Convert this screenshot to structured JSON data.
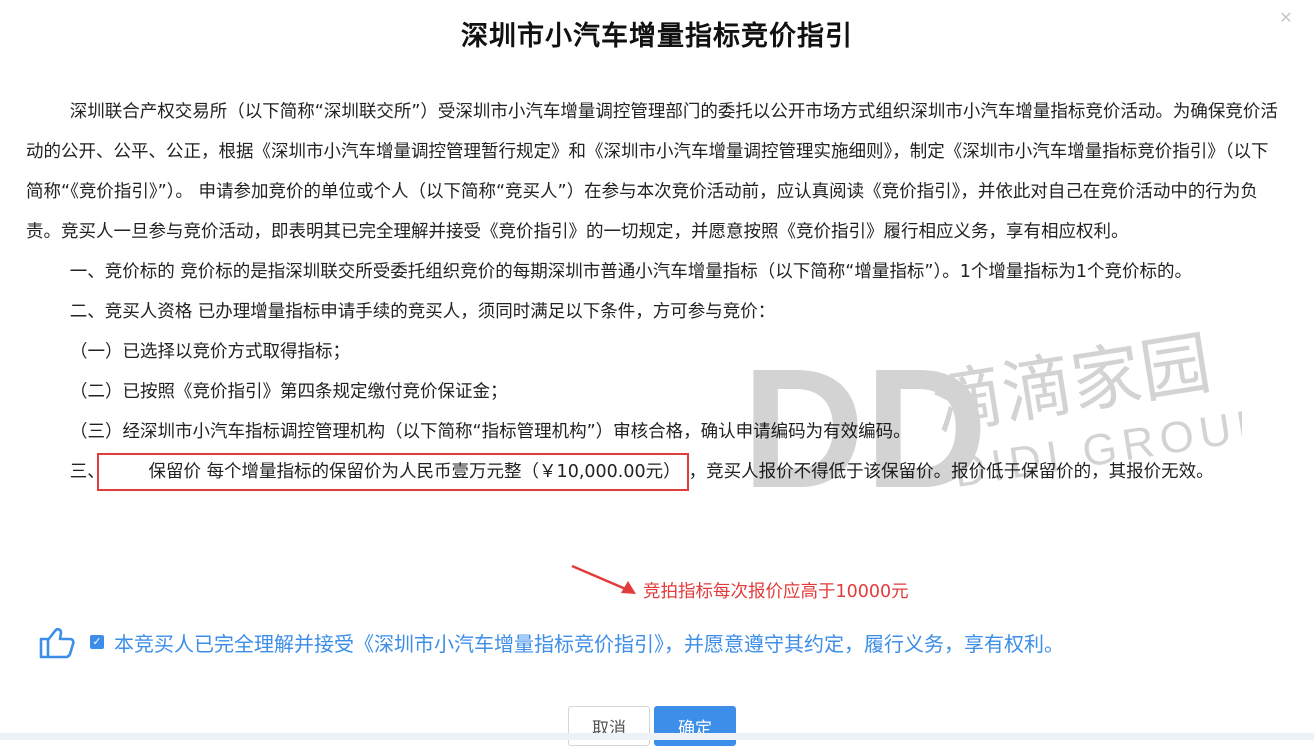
{
  "dialog": {
    "title": "深圳市小汽车增量指标竞价指引",
    "close_symbol": "✕"
  },
  "content": {
    "paragraphs": [
      "深圳联合产权交易所（以下简称“深圳联交所”）受深圳市小汽车增量调控管理部门的委托以公开市场方式组织深圳市小汽车增量指标竞价活动。为确保竞价活动的公开、公平、公正，根据《深圳市小汽车增量调控管理暂行规定》和《深圳市小汽车增量调控管理实施细则》，制定《深圳市小汽车增量指标竞价指引》（以下简称“《竞价指引》”）。 申请参加竞价的单位或个人（以下简称“竞买人”）在参与本次竞价活动前，应认真阅读《竞价指引》，并依此对自己在竞价活动中的行为负责。竞买人一旦参与竞价活动，即表明其已完全理解并接受《竞价指引》的一切规定，并愿意按照《竞价指引》履行相应义务，享有相应权利。",
      "一、竞价标的 竞价标的是指深圳联交所受委托组织竞价的每期深圳市普通小汽车增量指标（以下简称“增量指标”）。1个增量指标为1个竞价标的。",
      "二、竞买人资格 已办理增量指标申请手续的竞买人，须同时满足以下条件，方可参与竞价："
    ],
    "conditions": [
      "（一）已选择以竞价方式取得指标；",
      "（二）已按照《竞价指引》第四条规定缴付竞价保证金；",
      "（三）经深圳市小汽车指标调控管理机构（以下简称“指标管理机构”）审核合格，确认申请编码为有效编码。"
    ],
    "reserve": {
      "prefix": "三、",
      "highlighted": "保留价 每个增量指标的保留价为人民币壹万元整（￥10,000.00元）",
      "suffix": "，竞买人报价不得低于该保留价。报价低于保留价的，其报价无效。"
    }
  },
  "annotation": {
    "text": "竞拍指标每次报价应高于10000元",
    "color": "#e23b3b"
  },
  "agreement": {
    "checked": true,
    "check_symbol": "✓",
    "text": "本竞买人已完全理解并接受《深圳市小汽车增量指标竞价指引》，并愿意遵守其约定，履行义务，享有权利。",
    "icon": "thumbs-up-icon"
  },
  "buttons": {
    "cancel": "取消",
    "confirm": "确定"
  },
  "watermark": {
    "logo": "DD",
    "cn": "滴滴家园",
    "en": "DIDI GROUP"
  },
  "colors": {
    "accent": "#3c8ee8",
    "highlight": "#e23b3b"
  }
}
